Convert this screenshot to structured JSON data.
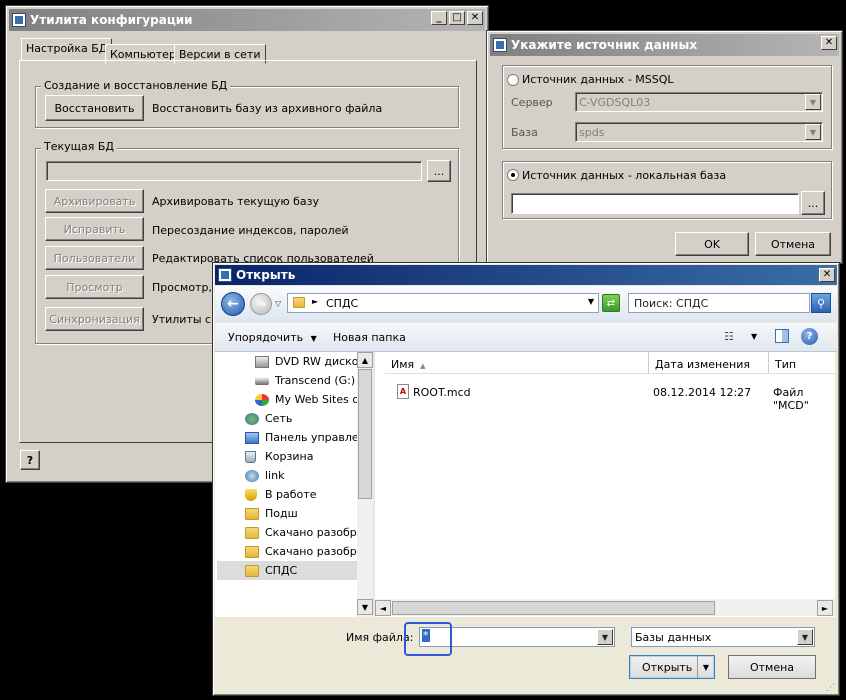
{
  "config_window": {
    "title": "Утилита конфигурации",
    "tabs": [
      "Настройка БД",
      "Компьютер",
      "Версии в сети"
    ],
    "group_restore": {
      "label": "Создание и восстановление БД",
      "restore_button": "Восстановить",
      "restore_desc": "Восстановить базу из архивного файла"
    },
    "group_current": {
      "label": "Текущая БД",
      "path_value": "",
      "browse_label": "...",
      "actions": [
        {
          "button": "Архивировать",
          "desc": "Архивировать текущую базу"
        },
        {
          "button": "Исправить",
          "desc": "Пересоздание индексов, паролей"
        },
        {
          "button": "Пользователи",
          "desc": "Редактировать список пользователей"
        },
        {
          "button": "Просмотр",
          "desc": "Просмотр, р"
        },
        {
          "button": "Синхронизация",
          "desc": "Утилиты си"
        }
      ]
    }
  },
  "source_dialog": {
    "title": "Укажите источник данных",
    "mssql_label": "Источник данных - MSSQL",
    "server_label": "Сервер",
    "server_value": "C-VGDSQL03",
    "base_label": "База",
    "base_value": "spds",
    "local_label": "Источник данных - локальная база",
    "local_path": "",
    "browse_label": "...",
    "ok": "OK",
    "cancel": "Отмена"
  },
  "open_dialog": {
    "title": "Открыть",
    "address": "СПДС",
    "search_placeholder": "Поиск: СПДС",
    "organize": "Упорядочить",
    "new_folder": "Новая папка",
    "tree": [
      {
        "label": "DVD RW дисково",
        "icon": "dvd-drive-icon"
      },
      {
        "label": "Transcend (G:)",
        "icon": "drive-icon"
      },
      {
        "label": "My Web Sites on",
        "icon": "web-sites-icon"
      },
      {
        "label": "Сеть",
        "icon": "network-icon"
      },
      {
        "label": "Панель управлен",
        "icon": "control-panel-icon"
      },
      {
        "label": "Корзина",
        "icon": "recycle-bin-icon"
      },
      {
        "label": "link",
        "icon": "link-icon"
      },
      {
        "label": "В работе",
        "icon": "shield-icon"
      },
      {
        "label": "Подш",
        "icon": "folder-icon"
      },
      {
        "label": "Скачано разобрат",
        "icon": "folder-icon"
      },
      {
        "label": "Скачано разобрат",
        "icon": "folder-icon"
      },
      {
        "label": "СПДС",
        "icon": "folder-icon"
      }
    ],
    "columns": [
      "Имя",
      "Дата изменения",
      "Тип"
    ],
    "files": [
      {
        "name": "ROOT.mcd",
        "date": "08.12.2014 12:27",
        "type": "Файл \"MCD\""
      }
    ],
    "filename_label": "Имя файла:",
    "filename_value": "*",
    "filetype_value": "Базы данных",
    "open_button": "Открыть",
    "cancel_button": "Отмена"
  }
}
